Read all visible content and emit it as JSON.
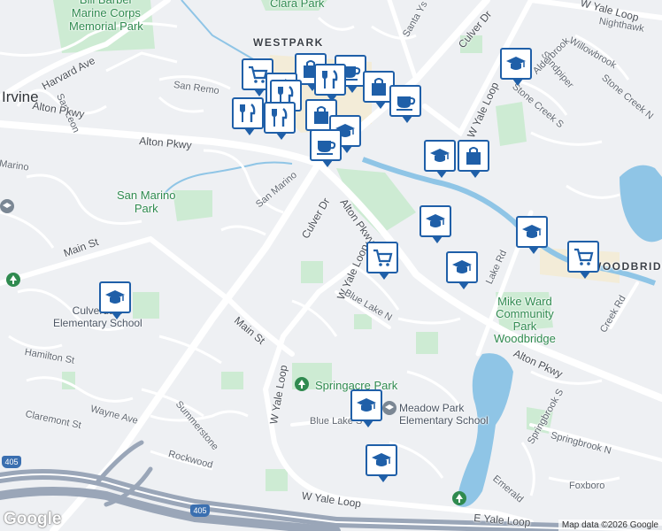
{
  "labels": {
    "bill_barber_park": "Bill Barber\nMarine Corps\nMemorial Park",
    "clara_park": "Clara Park",
    "westpark": "WESTPARK",
    "irvine": "Irvine",
    "woodbridge": "WOODBRIDGE",
    "harvard_ave": "Harvard Ave",
    "san_leon": "San Leon",
    "san_remo": "San Remo",
    "alton_pkwy_west": "Alton Pkwy",
    "alton_pkwy_left": "Alton Pkwy",
    "alton_pkwy_diag": "Alton Pkwy",
    "alton_pkwy_east": "Alton Pkwy",
    "marino": "Marino",
    "san_marino_park": "San Marino\nPark",
    "san_marino": "San Marino",
    "culver_dr_south": "Culver Dr",
    "culver_dr_north": "Culver Dr",
    "santa_ysabel": "Santa Ys",
    "w_yale_loop_ne": "W Yale Loop",
    "w_yale_loop_mid": "W Yale Loop",
    "w_yale_loop_west": "W Yale Loop",
    "w_yale_loop_south": "W Yale Loop",
    "e_yale_loop": "E Yale Loop",
    "nighthawk": "Nighthawk",
    "w_yale_loop_top": "W Yale Loop",
    "willowbrook": "Willowbrook",
    "sandpiper": "Sandpiper",
    "alderbrook": "Alderbrook",
    "stone_creek_s": "Stone Creek S",
    "stone_creek_n": "Stone Creek N",
    "main_st_west": "Main St",
    "main_st_mid": "Main St",
    "blue_lake_n": "Blue Lake N",
    "blue_lake_s": "Blue Lake S",
    "lake_rd": "Lake Rd",
    "creek_rd": "Creek Rd",
    "mike_ward_park": "Mike Ward\nCommunity\nPark\nWoodbridge",
    "culverdale": "Culverdale\nElementary School",
    "springacre_park": "Springacre Park",
    "meadow_park": "Meadow Park\nElementary School",
    "hamilton_st": "Hamilton St",
    "wayne_ave": "Wayne Ave",
    "claremont_st": "Claremont St",
    "summerstone": "Summerstone",
    "rockwood": "Rockwood",
    "springbrook_n": "Springbrook N",
    "springbrook_s": "Springbrook S",
    "emerald": "Emerald",
    "foxboro": "Foxboro",
    "i405": "405",
    "i405_b": "405",
    "google": "Google",
    "attribution": "Map data ©2026 Google"
  },
  "markers": [
    {
      "type": "shopping-cart"
    },
    {
      "type": "shopping-bag"
    },
    {
      "type": "coffee"
    },
    {
      "type": "restaurant"
    },
    {
      "type": "restaurant"
    },
    {
      "type": "restaurant"
    },
    {
      "type": "shopping-bag"
    },
    {
      "type": "coffee"
    },
    {
      "type": "restaurant"
    },
    {
      "type": "restaurant"
    },
    {
      "type": "shopping-bag"
    },
    {
      "type": "school"
    },
    {
      "type": "coffee"
    },
    {
      "type": "school"
    },
    {
      "type": "school"
    },
    {
      "type": "shopping-bag"
    },
    {
      "type": "school"
    },
    {
      "type": "shopping-cart"
    },
    {
      "type": "school"
    },
    {
      "type": "school"
    },
    {
      "type": "shopping-cart"
    },
    {
      "type": "school"
    },
    {
      "type": "school"
    },
    {
      "type": "school"
    }
  ],
  "colors": {
    "road": "#ffffff",
    "arterial": "#f7f7f7",
    "park": "#cdebd3",
    "water": "#8fc5e6",
    "freeway": "#9aa6b8",
    "marker_border": "#1f5fa8",
    "marker_icon": "#1f5fa8",
    "commercial": "#f3ecd8"
  }
}
